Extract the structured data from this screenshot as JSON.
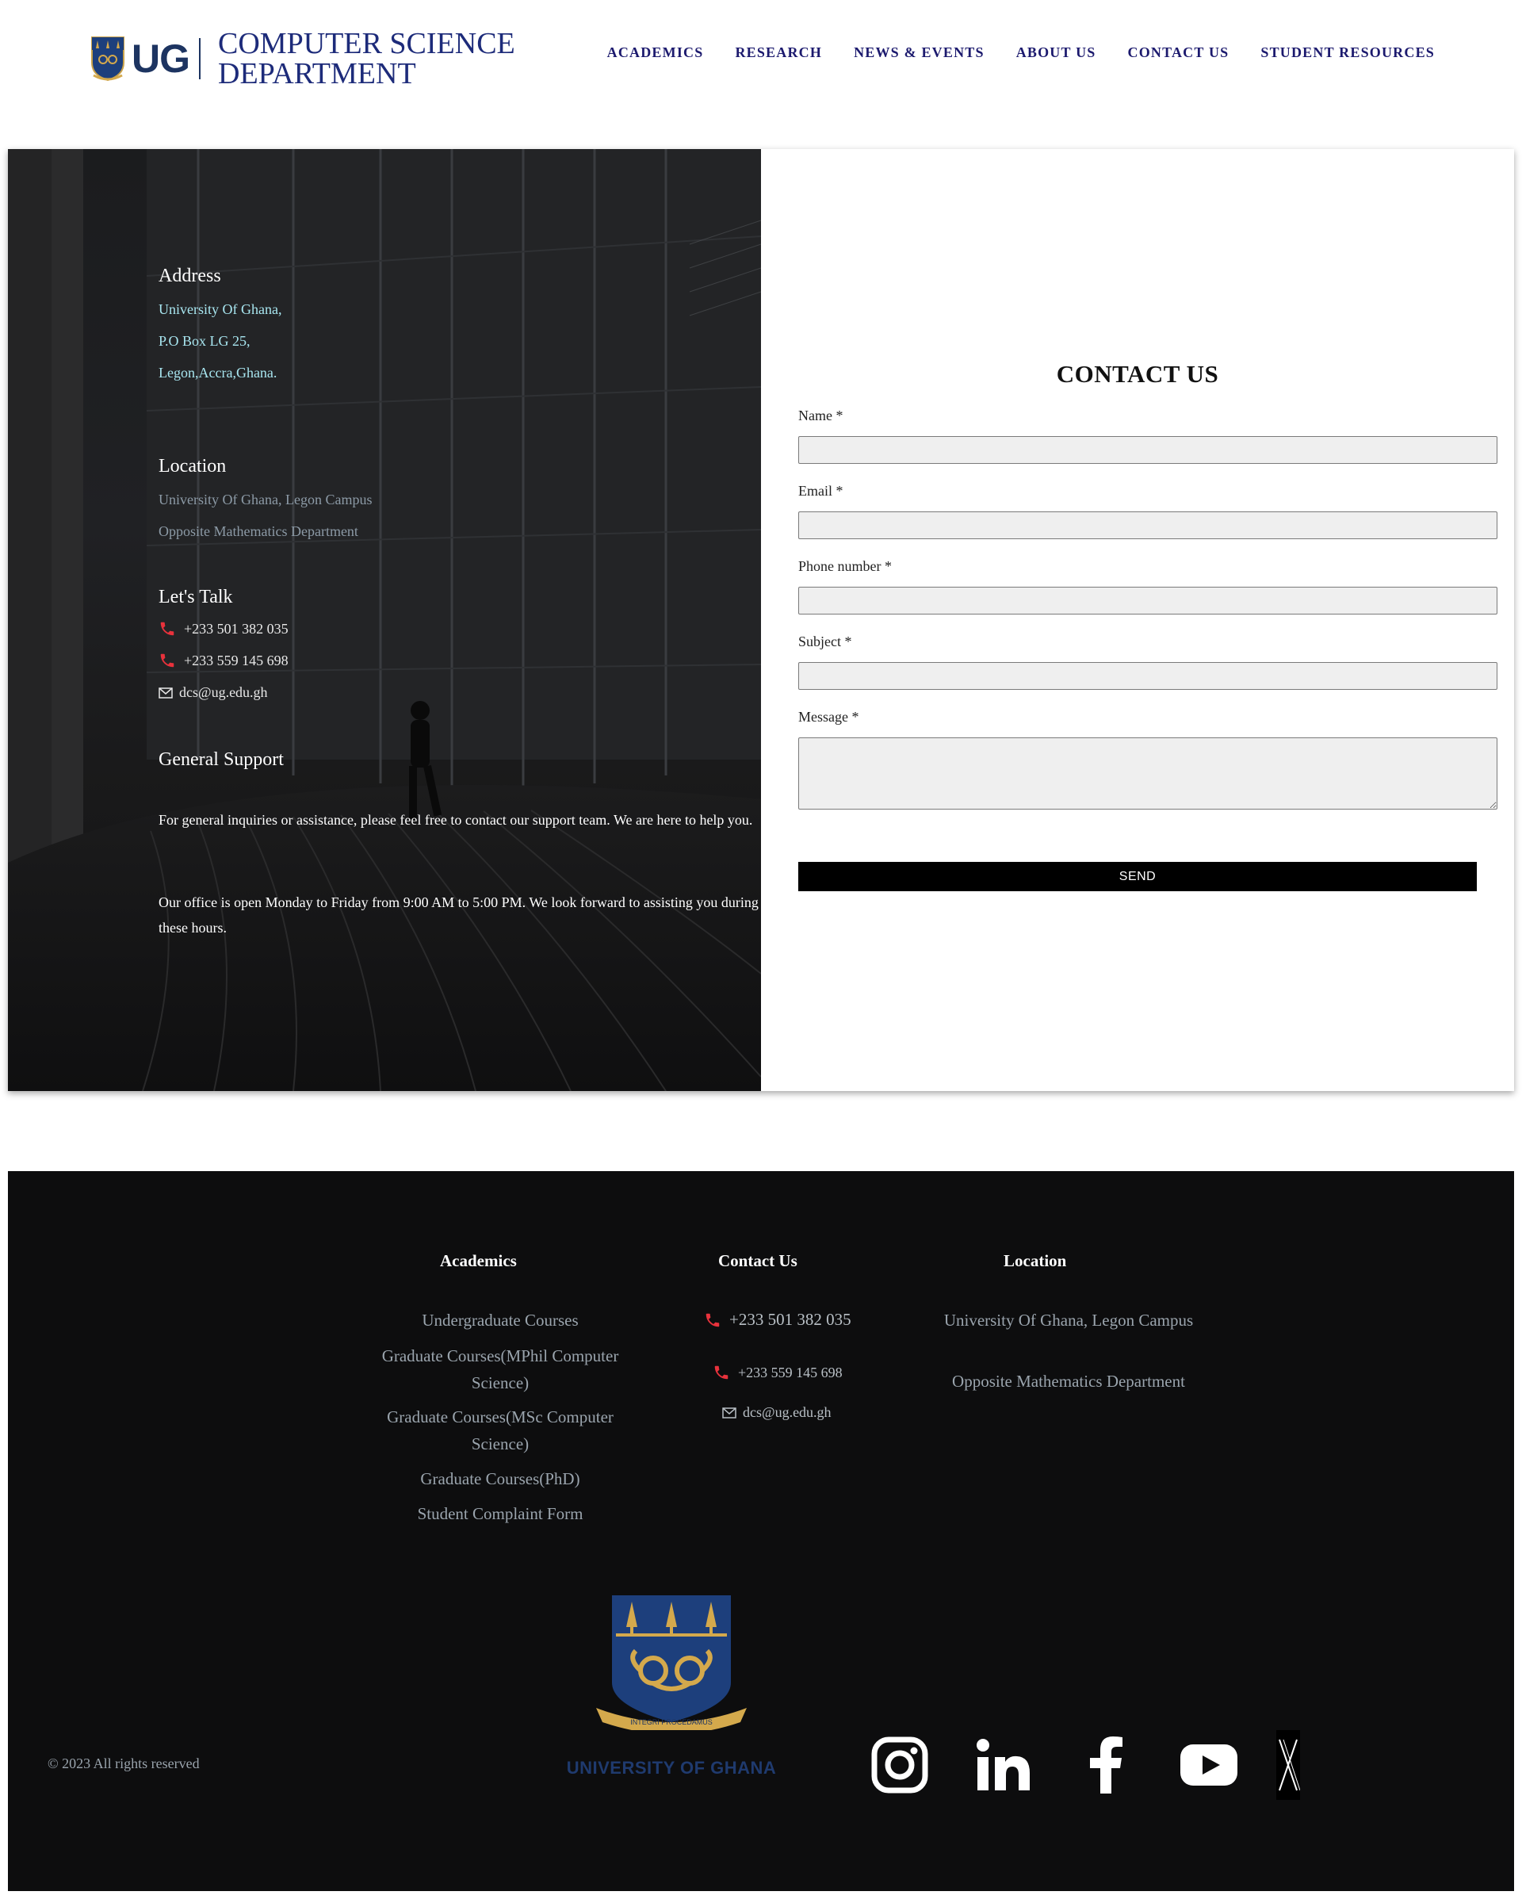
{
  "header": {
    "logo_text": "UG",
    "dept_line1": "COMPUTER SCIENCE",
    "dept_line2": "DEPARTMENT",
    "nav": [
      "ACADEMICS",
      "RESEARCH",
      "NEWS & EVENTS",
      "ABOUT US",
      "CONTACT US",
      "STUDENT RESOURCES"
    ]
  },
  "info": {
    "address_heading": "Address",
    "address_lines": [
      "University Of Ghana,",
      "P.O Box LG 25,",
      "Legon,Accra,Ghana."
    ],
    "location_heading": "Location",
    "location_lines": [
      "University Of Ghana, Legon Campus",
      "Opposite Mathematics Department"
    ],
    "talk_heading": "Let's Talk",
    "phones": [
      "+233 501 382 035",
      "+233 559 145 698"
    ],
    "email": "dcs@ug.edu.gh",
    "support_heading": "General Support",
    "support_para1": "For general inquiries or assistance, please feel free to contact our support team. We are here to help you.",
    "support_para2": "Our office is open Monday to Friday from 9:00 AM to 5:00 PM. We look forward to assisting you during these hours."
  },
  "form": {
    "title": "CONTACT US",
    "name_label": "Name *",
    "email_label": "Email *",
    "phone_label": "Phone number *",
    "subject_label": "Subject *",
    "message_label": "Message *",
    "name_value": "",
    "email_value": "",
    "phone_value": "",
    "subject_value": "",
    "send_label": "SEND"
  },
  "footer": {
    "academics_title": "Academics",
    "academics_links": [
      "Undergraduate Courses",
      "Graduate Courses(MPhil Computer Science)",
      "Graduate Courses(MSc Computer Science)",
      "Graduate Courses(PhD)",
      "Student Complaint Form"
    ],
    "contact_title": "Contact Us",
    "phones": [
      "+233 501 382 035",
      "+233 559 145 698"
    ],
    "email": "dcs@ug.edu.gh",
    "location_title": "Location",
    "location_lines": [
      "University Of Ghana, Legon Campus",
      "Opposite Mathematics Department"
    ],
    "crest_motto": "INTEGRI PROCEDAMUS",
    "university_name": "UNIVERSITY OF GHANA",
    "copyright": "© 2023 All rights reserved",
    "social_icons": [
      "instagram-icon",
      "linkedin-icon",
      "facebook-icon",
      "youtube-icon",
      "x-icon"
    ]
  },
  "colors": {
    "nav_text": "#1c1a6e",
    "brand_blue": "#1d3461",
    "accent_red": "#e8323c",
    "address_cyan": "#a8e6f0",
    "footer_bg": "#0d0d0e",
    "crest_gold": "#d4a94c"
  }
}
